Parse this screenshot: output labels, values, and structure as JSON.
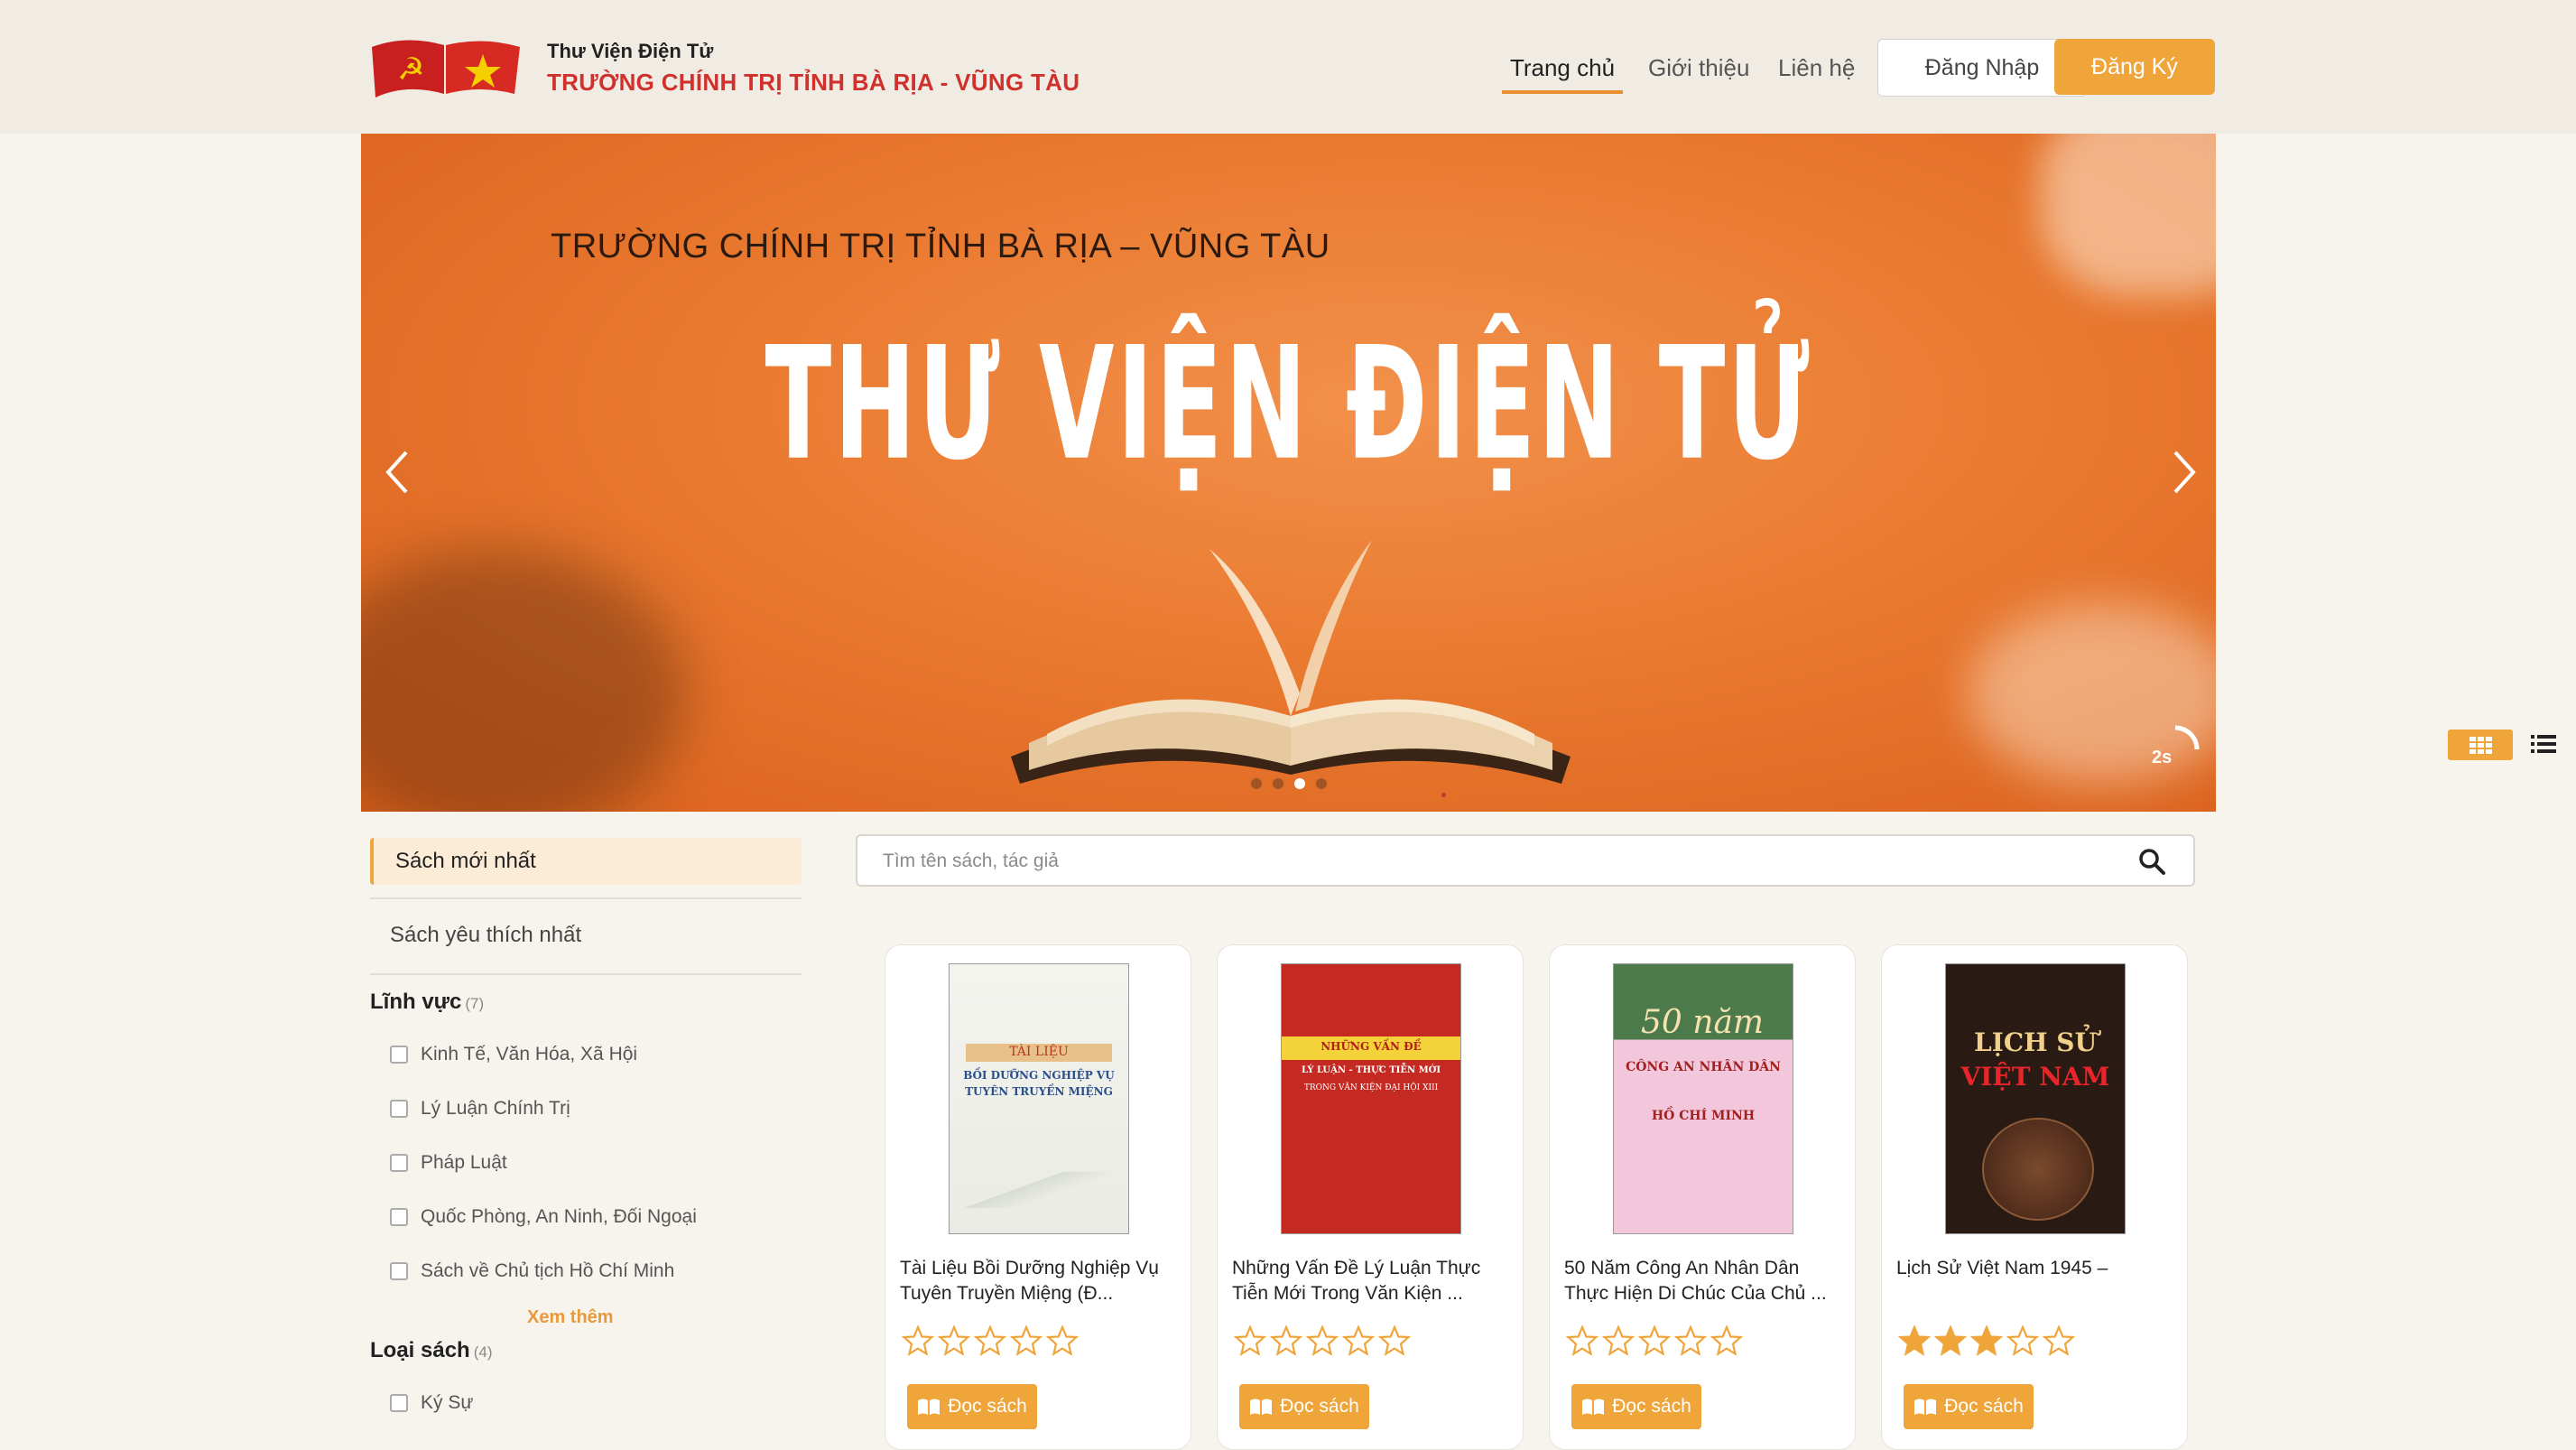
{
  "header": {
    "brand_top": "Thư Viện Điện Tử",
    "brand_main": "TRƯỜNG CHÍNH TRỊ TỈNH BÀ RỊA - VŨNG TÀU",
    "nav": {
      "home": "Trang chủ",
      "about": "Giới thiệu",
      "contact": "Liên hệ"
    },
    "login_label": "Đăng Nhập",
    "register_label": "Đăng Ký"
  },
  "banner": {
    "subtitle": "TRƯỜNG CHÍNH TRỊ TỈNH BÀ RỊA – VŨNG TÀU",
    "title": "THƯ VIỆN ĐIỆN TỬ",
    "timer": "2s",
    "active_slide": 3,
    "slide_count": 4
  },
  "sidebar": {
    "tab_newest": "Sách mới nhất",
    "tab_favorite": "Sách yêu thích nhất",
    "field": {
      "title": "Lĩnh vực",
      "count": "(7)",
      "items": [
        "Kinh Tế, Văn Hóa, Xã Hội",
        "Lý Luận Chính Trị",
        "Pháp Luật",
        "Quốc Phòng, An Ninh, Đối Ngoại",
        "Sách về Chủ tịch Hồ Chí Minh"
      ]
    },
    "see_more": "Xem thêm",
    "book_type": {
      "title": "Loại sách",
      "count": "(4)",
      "items": [
        "Ký Sự"
      ]
    }
  },
  "search": {
    "placeholder": "Tìm tên sách, tác giả",
    "value": ""
  },
  "books": [
    {
      "title": "Tài Liệu Bồi Dưỡng Nghiệp Vụ Tuyên Truyền Miệng (Đ...",
      "rating": 0,
      "read_label": "Đọc sách",
      "cover": {
        "line1": "TÀI LIỆU",
        "line2": "BỒI DƯỠNG NGHIỆP VỤ",
        "line3": "TUYÊN TRUYỀN MIỆNG"
      }
    },
    {
      "title": "Những Vấn Đề Lý Luận Thực Tiễn Mới Trong Văn Kiện ...",
      "rating": 0,
      "read_label": "Đọc sách",
      "cover": {
        "line1": "NHỮNG VẤN ĐỀ",
        "line2": "LÝ LUẬN - THỰC TIỄN MỚI",
        "line3": "TRONG VĂN KIỆN ĐẠI HỘI XIII"
      }
    },
    {
      "title": "50 Năm Công An Nhân Dân Thực Hiện Di Chúc Của Chủ ...",
      "rating": 0,
      "read_label": "Đọc sách",
      "cover": {
        "line1": "50 năm",
        "line2": "CÔNG AN NHÂN DÂN",
        "line3": "HỒ CHÍ MINH"
      }
    },
    {
      "title": "Lịch Sử Việt Nam 1945 –",
      "rating": 3,
      "read_label": "Đọc sách",
      "cover": {
        "line1": "LỊCH SỬ",
        "line2": "VIỆT NAM",
        "line3": ""
      }
    }
  ],
  "colors": {
    "accent": "#f0a53a",
    "brand_red": "#d0312d",
    "banner": "#ea7a30"
  }
}
